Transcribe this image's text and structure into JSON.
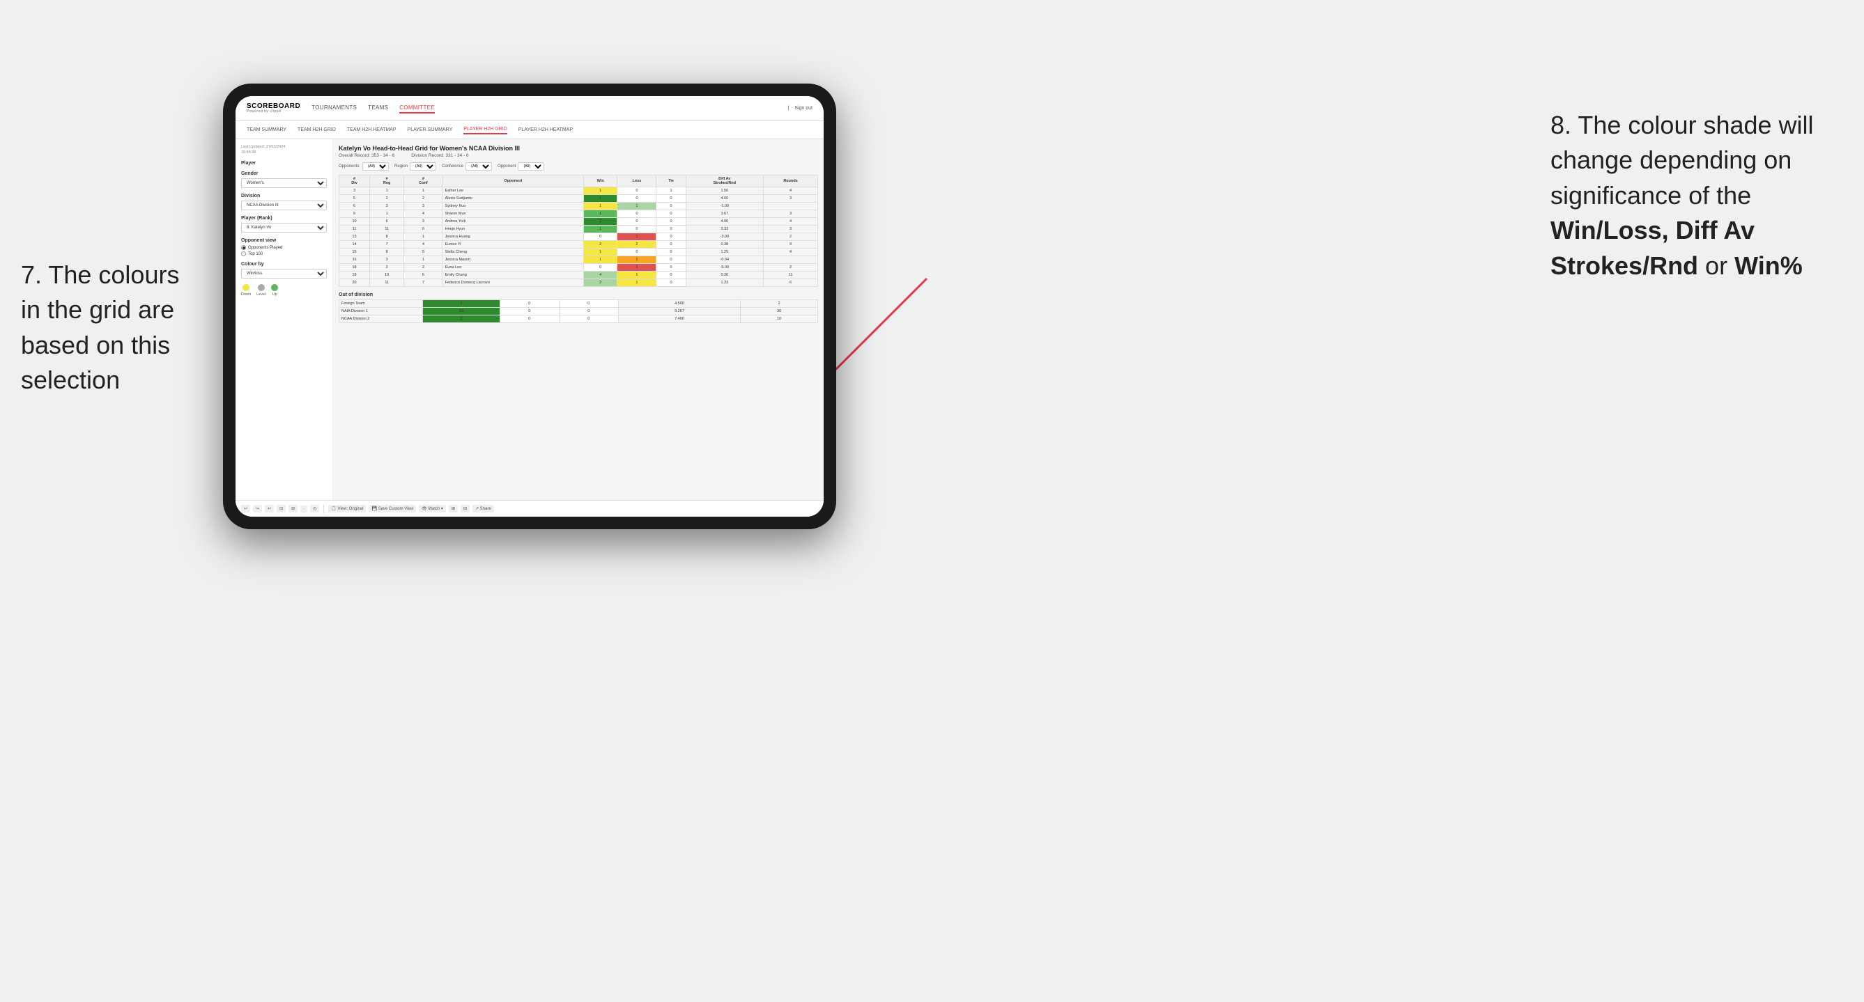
{
  "annotations": {
    "left_title": "7. The colours in the grid are based on this selection",
    "right_title": "8. The colour shade will change depending on significance of the ",
    "right_bold": "Win/Loss, Diff Av Strokes/Rnd",
    "right_or": " or ",
    "right_bold2": "Win%"
  },
  "nav": {
    "logo": "SCOREBOARD",
    "logo_sub": "Powered by clippd",
    "items": [
      "TOURNAMENTS",
      "TEAMS",
      "COMMITTEE"
    ],
    "active": "COMMITTEE",
    "right": [
      "Sign out"
    ]
  },
  "sub_nav": {
    "items": [
      "TEAM SUMMARY",
      "TEAM H2H GRID",
      "TEAM H2H HEATMAP",
      "PLAYER SUMMARY",
      "PLAYER H2H GRID",
      "PLAYER H2H HEATMAP"
    ],
    "active": "PLAYER H2H GRID"
  },
  "left_panel": {
    "last_updated_label": "Last Updated: 27/03/2024",
    "last_updated_time": "16:55:38",
    "player_label": "Player",
    "gender_label": "Gender",
    "gender_value": "Women's",
    "division_label": "Division",
    "division_value": "NCAA Division III",
    "player_rank_label": "Player (Rank)",
    "player_rank_value": "8. Katelyn Vo",
    "opponent_view_label": "Opponent view",
    "radio1": "Opponents Played",
    "radio2": "Top 100",
    "colour_by_label": "Colour by",
    "colour_by_value": "Win/loss",
    "legend": {
      "down_label": "Down",
      "level_label": "Level",
      "up_label": "Up"
    }
  },
  "grid": {
    "title": "Katelyn Vo Head-to-Head Grid for Women's NCAA Division III",
    "overall_record_label": "Overall Record:",
    "overall_record": "353 - 34 - 6",
    "division_record_label": "Division Record:",
    "division_record": "331 - 34 - 6",
    "filters": {
      "opponents_label": "Opponents:",
      "opponents_value": "(All)",
      "region_label": "Region",
      "region_value": "(All)",
      "conference_label": "Conference",
      "conference_value": "(All)",
      "opponent_label": "Opponent",
      "opponent_value": "(All)"
    },
    "table_headers": [
      "#Div",
      "#Reg",
      "#Conf",
      "Opponent",
      "Win",
      "Loss",
      "Tie",
      "Diff Av Strokes/Rnd",
      "Rounds"
    ],
    "rows": [
      {
        "div": "3",
        "reg": "1",
        "conf": "1",
        "name": "Esther Lee",
        "win": 1,
        "loss": 0,
        "tie": 1,
        "diff": "1.50",
        "rounds": 4,
        "win_cell": "yellow",
        "loss_cell": "white",
        "tie_cell": "white"
      },
      {
        "div": "5",
        "reg": "2",
        "conf": "2",
        "name": "Alexis Sudjianto",
        "win": 1,
        "loss": 0,
        "tie": 0,
        "diff": "4.00",
        "rounds": 3,
        "win_cell": "green_dark",
        "loss_cell": "white",
        "tie_cell": "white"
      },
      {
        "div": "6",
        "reg": "3",
        "conf": "3",
        "name": "Sydney Kuo",
        "win": 1,
        "loss": 1,
        "tie": 0,
        "diff": "-1.00",
        "rounds": "",
        "win_cell": "yellow",
        "loss_cell": "green_light",
        "tie_cell": "white"
      },
      {
        "div": "9",
        "reg": "1",
        "conf": "4",
        "name": "Sharon Mun",
        "win": 1,
        "loss": 0,
        "tie": 0,
        "diff": "3.67",
        "rounds": 3,
        "win_cell": "green_mid",
        "loss_cell": "white",
        "tie_cell": "white"
      },
      {
        "div": "10",
        "reg": "6",
        "conf": "3",
        "name": "Andrea York",
        "win": 2,
        "loss": 0,
        "tie": 0,
        "diff": "4.00",
        "rounds": 4,
        "win_cell": "green_dark",
        "loss_cell": "white",
        "tie_cell": "white"
      },
      {
        "div": "11",
        "reg": "11",
        "conf": "6",
        "name": "Heejo Hyun",
        "win": 1,
        "loss": 0,
        "tie": 0,
        "diff": "3.33",
        "rounds": 3,
        "win_cell": "green_mid",
        "loss_cell": "white",
        "tie_cell": "white"
      },
      {
        "div": "13",
        "reg": "8",
        "conf": "1",
        "name": "Jessica Huang",
        "win": 0,
        "loss": 1,
        "tie": 0,
        "diff": "-3.00",
        "rounds": 2,
        "win_cell": "white",
        "loss_cell": "red",
        "tie_cell": "white"
      },
      {
        "div": "14",
        "reg": "7",
        "conf": "4",
        "name": "Eunice Yi",
        "win": 2,
        "loss": 2,
        "tie": 0,
        "diff": "0.38",
        "rounds": 9,
        "win_cell": "yellow",
        "loss_cell": "yellow",
        "tie_cell": "white"
      },
      {
        "div": "15",
        "reg": "8",
        "conf": "5",
        "name": "Stella Cheng",
        "win": 1,
        "loss": 0,
        "tie": 0,
        "diff": "1.25",
        "rounds": 4,
        "win_cell": "yellow",
        "loss_cell": "white",
        "tie_cell": "white"
      },
      {
        "div": "16",
        "reg": "3",
        "conf": "1",
        "name": "Jessica Mason",
        "win": 1,
        "loss": 2,
        "tie": 0,
        "diff": "-0.94",
        "rounds": "",
        "win_cell": "yellow",
        "loss_cell": "orange",
        "tie_cell": "white"
      },
      {
        "div": "18",
        "reg": "2",
        "conf": "2",
        "name": "Euna Lee",
        "win": 0,
        "loss": 1,
        "tie": 0,
        "diff": "-5.00",
        "rounds": 2,
        "win_cell": "white",
        "loss_cell": "red",
        "tie_cell": "white"
      },
      {
        "div": "19",
        "reg": "10",
        "conf": "6",
        "name": "Emily Chang",
        "win": 4,
        "loss": 1,
        "tie": 0,
        "diff": "0.30",
        "rounds": 11,
        "win_cell": "green_light",
        "loss_cell": "yellow",
        "tie_cell": "white"
      },
      {
        "div": "20",
        "reg": "11",
        "conf": "7",
        "name": "Federica Domecq Lacroze",
        "win": 2,
        "loss": 1,
        "tie": 0,
        "diff": "1.33",
        "rounds": 6,
        "win_cell": "green_light",
        "loss_cell": "yellow",
        "tie_cell": "white"
      }
    ],
    "out_of_division_label": "Out of division",
    "out_of_division_rows": [
      {
        "name": "Foreign Team",
        "win": 1,
        "loss": 0,
        "tie": 0,
        "diff": "4.500",
        "rounds": 2,
        "win_cell": "green_dark",
        "loss_cell": "white",
        "tie_cell": "white"
      },
      {
        "name": "NAIA Division 1",
        "win": 15,
        "loss": 0,
        "tie": 0,
        "diff": "9.267",
        "rounds": 30,
        "win_cell": "green_dark",
        "loss_cell": "white",
        "tie_cell": "white"
      },
      {
        "name": "NCAA Division 2",
        "win": 5,
        "loss": 0,
        "tie": 0,
        "diff": "7.400",
        "rounds": 10,
        "win_cell": "green_dark",
        "loss_cell": "white",
        "tie_cell": "white"
      }
    ]
  },
  "toolbar": {
    "buttons": [
      "↩",
      "↪",
      "↩",
      "⊡",
      "⊟",
      "·",
      "◷",
      "|",
      "View: Original",
      "Save Custom View",
      "Watch ▾",
      "⊞",
      "Share"
    ]
  }
}
